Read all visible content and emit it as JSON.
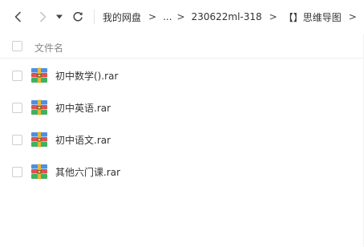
{
  "toolbar": {
    "back_icon": "chevron-left-icon",
    "forward_icon": "chevron-right-icon",
    "history_icon": "caret-down-icon",
    "refresh_icon": "refresh-icon",
    "breadcrumb": [
      {
        "label": "我的网盘"
      },
      {
        "label": "..."
      },
      {
        "label": "230622ml-318"
      },
      {
        "label": "【】思维导图"
      }
    ],
    "separator": ">"
  },
  "list": {
    "header": {
      "name_label": "文件名"
    },
    "files": [
      {
        "name": "初中数学().rar",
        "icon": "rar-archive-icon"
      },
      {
        "name": "初中英语.rar",
        "icon": "rar-archive-icon"
      },
      {
        "name": "初中语文.rar",
        "icon": "rar-archive-icon"
      },
      {
        "name": "其他六门课.rar",
        "icon": "rar-archive-icon"
      }
    ]
  },
  "colors": {
    "text": "#333333",
    "muted": "#888888",
    "border": "#eeeeee",
    "disabled": "#c8c8c8"
  }
}
